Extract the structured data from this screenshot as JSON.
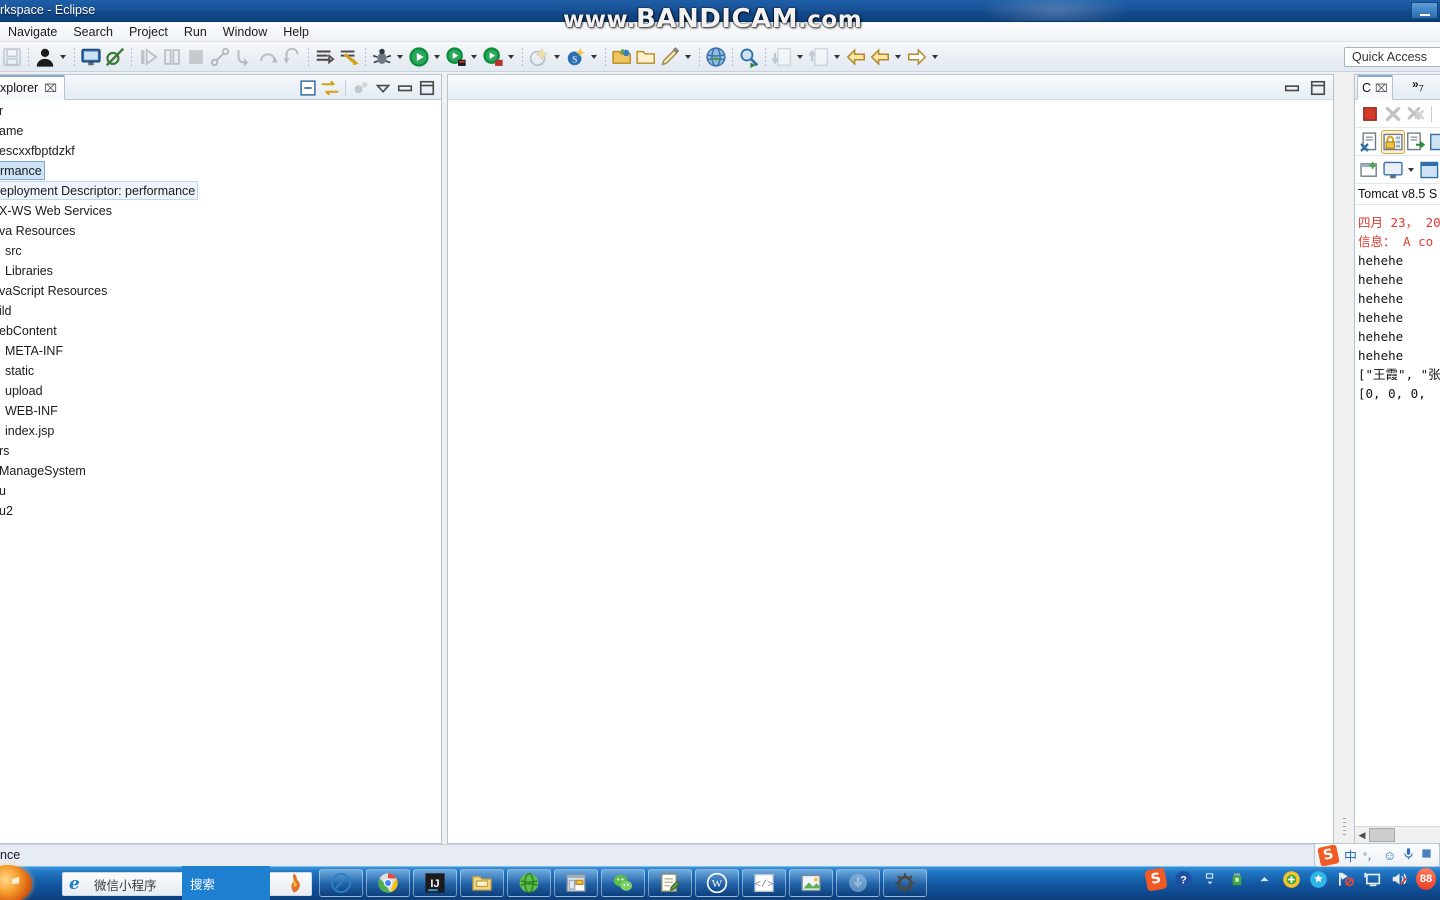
{
  "window": {
    "title": "rkspace - Eclipse",
    "watermark": "www.BANDICAM.com",
    "watermark_prefix": "www.",
    "watermark_main": "BANDICAM",
    "watermark_suffix": ".com"
  },
  "menubar": {
    "items": [
      {
        "label": "Navigate",
        "name": "menu-navigate"
      },
      {
        "label": "Search",
        "name": "menu-search"
      },
      {
        "label": "Project",
        "name": "menu-project"
      },
      {
        "label": "Run",
        "name": "menu-run"
      },
      {
        "label": "Window",
        "name": "menu-window"
      },
      {
        "label": "Help",
        "name": "menu-help"
      }
    ]
  },
  "quick_access": {
    "label": "Quick Access"
  },
  "explorer": {
    "tab_label": "xplorer",
    "tab_close": "⌧",
    "tree": [
      {
        "label": "r",
        "indent": 0,
        "state": "normal"
      },
      {
        "label": "ame",
        "indent": 0,
        "state": "normal"
      },
      {
        "label": "escxxfbptdzkf",
        "indent": 0,
        "state": "normal"
      },
      {
        "label": "rmance",
        "indent": 0,
        "state": "selected"
      },
      {
        "label": "eployment Descriptor: performance",
        "indent": 0,
        "state": "boxed"
      },
      {
        "label": "X-WS Web Services",
        "indent": 0,
        "state": "normal"
      },
      {
        "label": "va Resources",
        "indent": 0,
        "state": "normal"
      },
      {
        "label": "src",
        "indent": 6,
        "state": "normal"
      },
      {
        "label": "Libraries",
        "indent": 6,
        "state": "normal"
      },
      {
        "label": "vaScript Resources",
        "indent": 0,
        "state": "normal"
      },
      {
        "label": "ild",
        "indent": 0,
        "state": "normal"
      },
      {
        "label": "ebContent",
        "indent": 0,
        "state": "normal"
      },
      {
        "label": "META-INF",
        "indent": 6,
        "state": "normal"
      },
      {
        "label": "static",
        "indent": 6,
        "state": "normal"
      },
      {
        "label": "upload",
        "indent": 6,
        "state": "normal"
      },
      {
        "label": "WEB-INF",
        "indent": 6,
        "state": "normal"
      },
      {
        "label": "index.jsp",
        "indent": 6,
        "state": "normal"
      },
      {
        "label": "rs",
        "indent": 0,
        "state": "normal"
      },
      {
        "label": "ManageSystem",
        "indent": 0,
        "state": "normal"
      },
      {
        "label": "u",
        "indent": 0,
        "state": "normal"
      },
      {
        "label": "u2",
        "indent": 0,
        "state": "normal"
      }
    ]
  },
  "console": {
    "tab_label": "C",
    "tab_close": "⌧",
    "overflow_label": "»",
    "overflow_count": "7",
    "title": "Tomcat v8.5 S",
    "output": [
      {
        "text": "四月 23， 20",
        "color": "red"
      },
      {
        "text": "信息： A co",
        "color": "red"
      },
      {
        "text": "hehehe",
        "color": "black"
      },
      {
        "text": "hehehe",
        "color": "black"
      },
      {
        "text": "hehehe",
        "color": "black"
      },
      {
        "text": "hehehe",
        "color": "black"
      },
      {
        "text": "hehehe",
        "color": "black"
      },
      {
        "text": "hehehe",
        "color": "black"
      },
      {
        "text": "[\"王霞\", \"张",
        "color": "black"
      },
      {
        "text": "[0, 0, 0,",
        "color": "black"
      }
    ]
  },
  "statusbar": {
    "text": "nce"
  },
  "ime": {
    "mode_label": "中",
    "punct_label": "°，",
    "emoji": "☺",
    "mic": "🎤"
  },
  "taskbar": {
    "ie_label": "微信小程序",
    "search_label": "搜索",
    "apps": [
      {
        "name": "taskbar-app-sogou-pinyin",
        "icon": "circle-slash-icon"
      },
      {
        "name": "taskbar-app-chrome",
        "icon": "chrome-icon"
      },
      {
        "name": "taskbar-app-intellij-idea",
        "icon": "ij-icon",
        "text": "IJ"
      },
      {
        "name": "taskbar-app-file-explorer",
        "icon": "folder-icon"
      },
      {
        "name": "taskbar-app-navicat",
        "icon": "green-globe-icon"
      },
      {
        "name": "taskbar-app-eclipse",
        "icon": "eclipse-window-icon"
      },
      {
        "name": "taskbar-app-wechat",
        "icon": "wechat-icon"
      },
      {
        "name": "taskbar-app-notepad",
        "icon": "notepad-icon"
      },
      {
        "name": "taskbar-app-wps-writer",
        "icon": "wps-w-icon"
      },
      {
        "name": "taskbar-app-code-editor",
        "icon": "code-brackets-icon"
      },
      {
        "name": "taskbar-app-image-viewer",
        "icon": "picture-icon"
      },
      {
        "name": "taskbar-app-download",
        "icon": "download-arrow-icon"
      },
      {
        "name": "taskbar-app-settings",
        "icon": "gear-icon"
      }
    ],
    "tray_badge": "88"
  },
  "colors": {
    "titlebar": "#1a5296",
    "accent": "#1f7fd0",
    "selection": "#cfe3f7",
    "console_red": "#e0392f",
    "taskbar": "#12559e"
  }
}
